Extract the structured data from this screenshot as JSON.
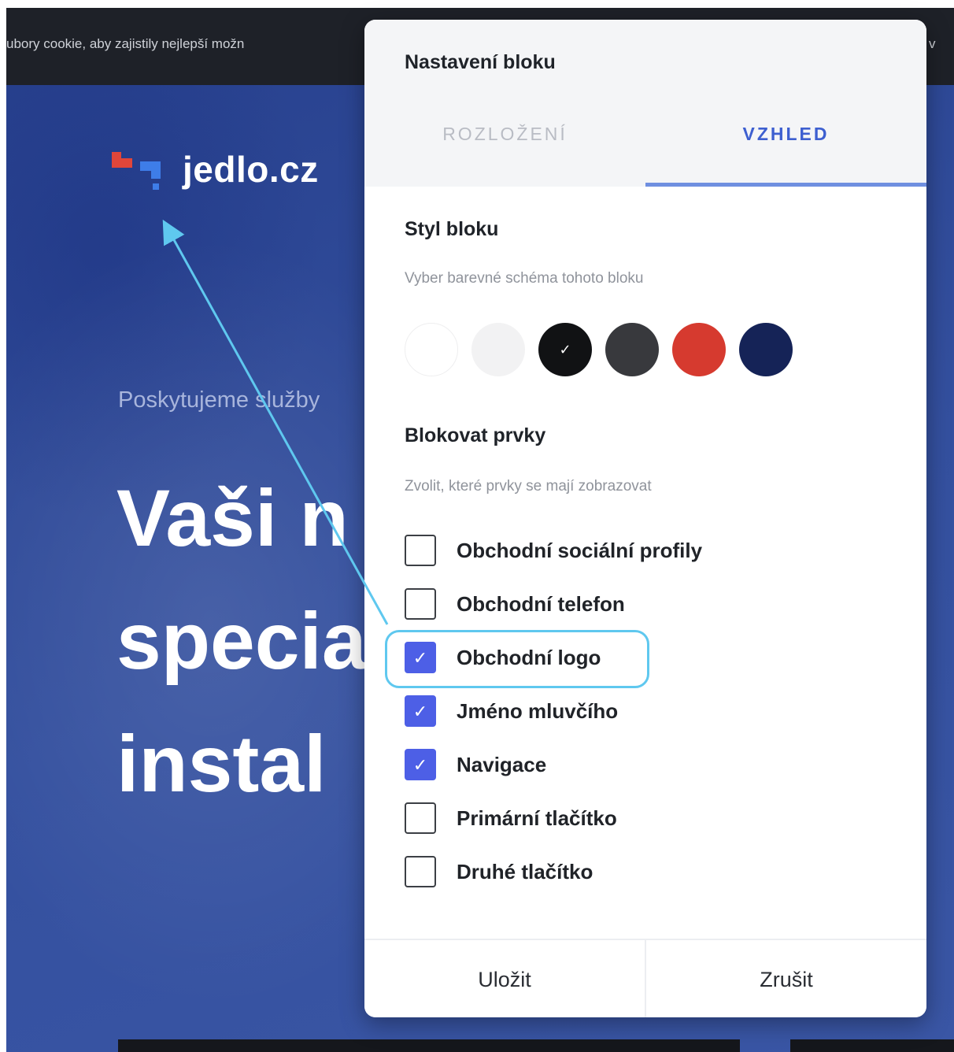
{
  "site": {
    "cookie_text": "ubory cookie, aby zajistily nejlepší možn",
    "cookie_tail": "v",
    "logo_text": "jedlo.cz",
    "eyebrow": "Poskytujeme služby",
    "hero_lines": [
      "Vaši n",
      "specia",
      "instal"
    ]
  },
  "modal": {
    "title": "Nastavení bloku",
    "tabs": [
      {
        "label": "ROZLOŽENÍ",
        "active": false
      },
      {
        "label": "VZHLED",
        "active": true
      }
    ],
    "style_section": {
      "title": "Styl bloku",
      "description": "Vyber barevné schéma tohoto bloku",
      "swatches": [
        {
          "color": "#ffffff",
          "selected": false
        },
        {
          "color": "#f2f2f3",
          "selected": false
        },
        {
          "color": "#111214",
          "selected": true
        },
        {
          "color": "#38393d",
          "selected": false
        },
        {
          "color": "#d63a2f",
          "selected": false
        },
        {
          "color": "#152357",
          "selected": false
        }
      ]
    },
    "elements_section": {
      "title": "Blokovat prvky",
      "description": "Zvolit, které prvky se mají zobrazovat",
      "items": [
        {
          "label": "Obchodní sociální profily",
          "checked": false
        },
        {
          "label": "Obchodní telefon",
          "checked": false
        },
        {
          "label": "Obchodní logo",
          "checked": true
        },
        {
          "label": "Jméno mluvčího",
          "checked": true
        },
        {
          "label": "Navigace",
          "checked": true
        },
        {
          "label": "Primární tlačítko",
          "checked": false
        },
        {
          "label": "Druhé tlačítko",
          "checked": false
        }
      ]
    },
    "footer": {
      "save_label": "Uložit",
      "cancel_label": "Zrušit"
    }
  },
  "colors": {
    "accent": "#4d5fe6",
    "highlight": "#5fc8ef",
    "site_background": "#2f4a9a"
  }
}
